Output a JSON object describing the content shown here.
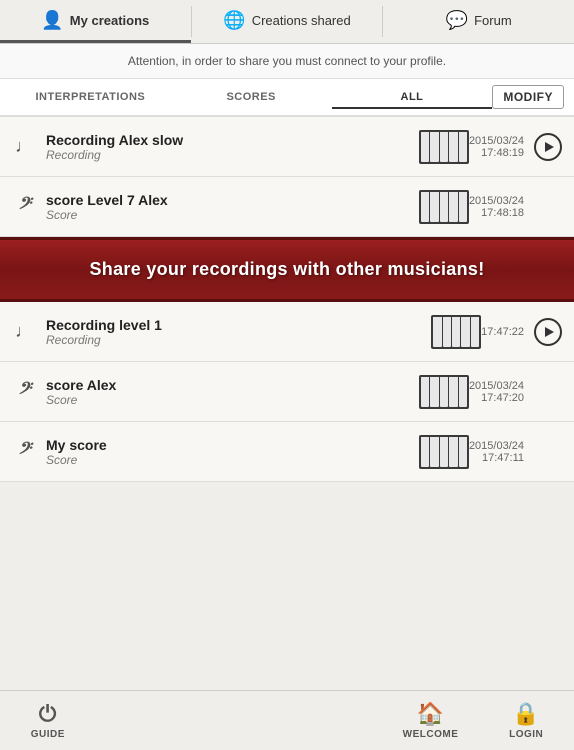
{
  "nav": {
    "tabs": [
      {
        "id": "my-creations",
        "label": "My creations",
        "icon": "👤",
        "active": true
      },
      {
        "id": "creations-shared",
        "label": "Creations shared",
        "icon": "🌐",
        "active": false
      },
      {
        "id": "forum",
        "label": "Forum",
        "icon": "💬",
        "active": false
      }
    ]
  },
  "attention": {
    "text": "Attention, in order to share you must connect to your profile."
  },
  "filters": {
    "tabs": [
      {
        "id": "interpretations",
        "label": "INTERPRETATIONS",
        "active": false
      },
      {
        "id": "scores",
        "label": "SCORES",
        "active": false
      },
      {
        "id": "all",
        "label": "ALL",
        "active": true
      }
    ],
    "modify_label": "MODIFY"
  },
  "items": [
    {
      "id": "item1",
      "title": "Recording Alex slow",
      "subtitle": "Recording",
      "date": "2015/03/24",
      "time": "17:48:19",
      "type": "recording",
      "hasPlay": true
    },
    {
      "id": "item2",
      "title": "score Level 7 Alex",
      "subtitle": "Score",
      "date": "2015/03/24",
      "time": "17:48:18",
      "type": "score",
      "hasPlay": false
    },
    {
      "id": "item3",
      "title": "Recording level 1",
      "subtitle": "Recording",
      "date": "",
      "time": "17:47:22",
      "type": "recording",
      "hasPlay": true
    },
    {
      "id": "item4",
      "title": "score Alex",
      "subtitle": "Score",
      "date": "2015/03/24",
      "time": "17:47:20",
      "type": "score",
      "hasPlay": false
    },
    {
      "id": "item5",
      "title": "My score",
      "subtitle": "Score",
      "date": "2015/03/24",
      "time": "17:47:11",
      "type": "score",
      "hasPlay": false
    }
  ],
  "promo": {
    "text": "Share your recordings with other musicians!"
  },
  "bottom_nav": {
    "items": [
      {
        "id": "guide",
        "label": "GUIDE",
        "icon": "⏻"
      },
      {
        "id": "welcome",
        "label": "WELCOME",
        "icon": "🏠"
      },
      {
        "id": "login",
        "label": "LOGIN",
        "icon": "🔒"
      }
    ]
  }
}
